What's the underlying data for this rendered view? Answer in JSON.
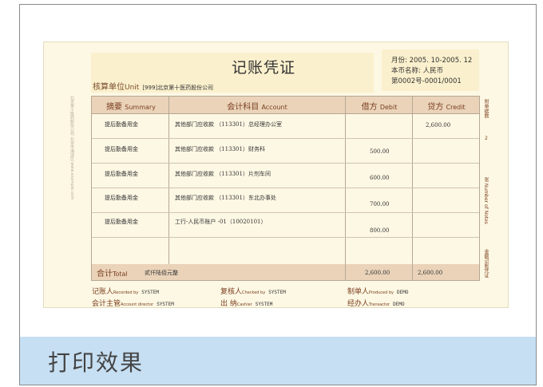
{
  "voucher": {
    "title": "记账凭证",
    "unit_label": "核算单位",
    "unit_label_en": "Unit",
    "unit_value": "[999]北京第十医药股份公司",
    "month": "月份: 2005. 10-2005. 12",
    "currency": "本币名称: 人民币",
    "number": "第0002号-0001/0001"
  },
  "columns": {
    "summary": "摘要",
    "summary_en": "Summary",
    "account": "会计科目",
    "account_en": "Account",
    "debit": "借方",
    "debit_en": "Debit",
    "credit": "贷方",
    "credit_en": "Credit"
  },
  "rows": [
    {
      "summary": "提后勤备用金",
      "account": "其他部门应收款  （113301）总经理办公室",
      "debit": "",
      "credit": "2,600.00"
    },
    {
      "summary": "提后勤备用金",
      "account": "其他部门应收款  （113301）财务科",
      "debit": "500.00",
      "credit": ""
    },
    {
      "summary": "提后勤备用金",
      "account": "其他部门应收款  （113301）片剂车间",
      "debit": "600.00",
      "credit": ""
    },
    {
      "summary": "提后勤备用金",
      "account": "其他部门应收款  （113301）东北办事处",
      "debit": "700.00",
      "credit": ""
    },
    {
      "summary": "提后勤备用金",
      "account": "工行-人民币账户 -01（10020101）",
      "debit": "800.00",
      "credit": ""
    }
  ],
  "total": {
    "label": "合计",
    "label_en": "Total",
    "words": "贰仟陆佰元整",
    "debit": "2,600.00",
    "credit": "2,600.00"
  },
  "signatures": {
    "recorded_by": {
      "label": "记账人",
      "en": "Recorded by",
      "value": "SYSTEM"
    },
    "checked_by": {
      "label": "复核人",
      "en": "Checked by",
      "value": "SYSTEM"
    },
    "produced_by": {
      "label": "制单人",
      "en": "Produced by",
      "value": "DEMO"
    },
    "director": {
      "label": "会计主管",
      "en": "Account director",
      "value": "SYSTEM"
    },
    "cashier": {
      "label": "出  纳",
      "en": "Cashier",
      "value": "SYSTEM"
    },
    "transactor": {
      "label": "经办人",
      "en": "Transactor",
      "value": "DEMO"
    }
  },
  "side": {
    "left": "北京第十医药股份公司  北京市海淀区  www.example.com",
    "right_top": "附单据数",
    "right_count": "2",
    "right_mid": "张 Number of Notes",
    "right_bottom": "金额记账凭证"
  },
  "footer": {
    "caption": "打印效果"
  }
}
